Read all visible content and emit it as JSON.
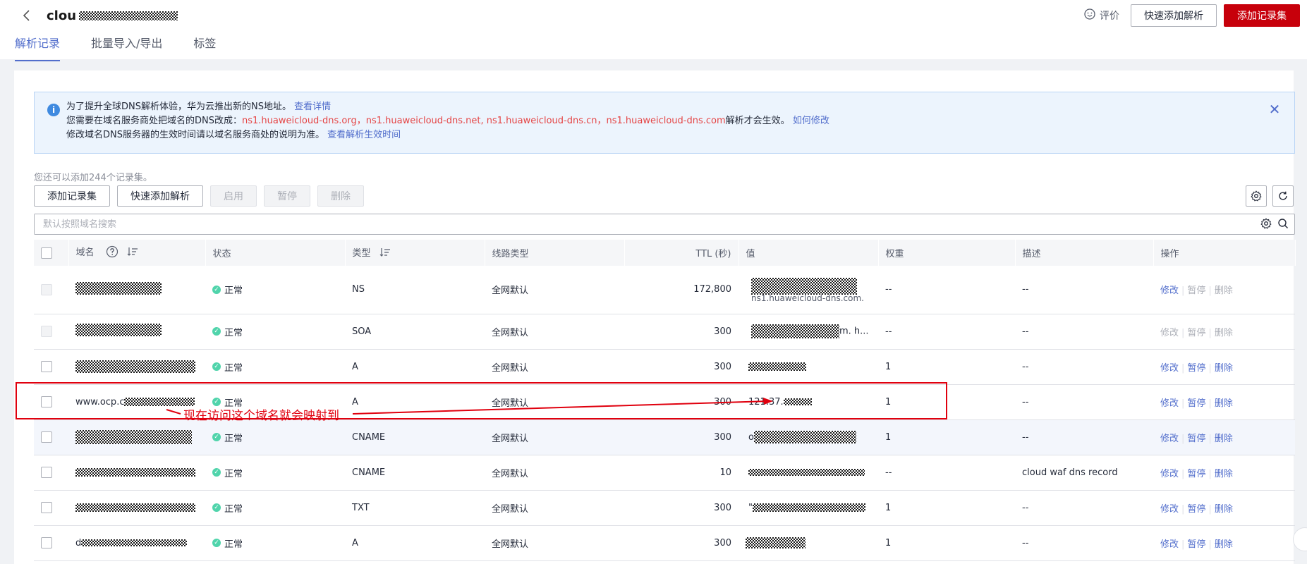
{
  "header": {
    "title": "clou",
    "tabs": [
      "解析记录",
      "批量导入/导出",
      "标签"
    ],
    "rate_label": "评价",
    "quick_add_label": "快速添加解析",
    "add_record_label": "添加记录集"
  },
  "banner": {
    "line1_text": "为了提升全球DNS解析体验，华为云推出新的NS地址。",
    "line1_link": "查看详情",
    "line2_prefix": "您需要在域名服务商处把域名的DNS改成：",
    "line2_ns": "ns1.huaweicloud-dns.org，ns1.huaweicloud-dns.net, ns1.huaweicloud-dns.cn，ns1.huaweicloud-dns.com",
    "line2_suffix": "解析才会生效。",
    "line2_link": "如何修改",
    "line3_text": "修改域名DNS服务器的生效时间请以域名服务商处的说明为准。",
    "line3_link": "查看解析生效时间"
  },
  "toolbar": {
    "remaining": "您还可以添加244个记录集。",
    "add_label": "添加记录集",
    "quick_label": "快速添加解析",
    "enable_label": "启用",
    "pause_label": "暂停",
    "delete_label": "删除"
  },
  "search": {
    "placeholder": "默认按照域名搜索"
  },
  "table": {
    "headers": {
      "name": "域名",
      "status": "状态",
      "type": "类型",
      "line": "线路类型",
      "ttl": "TTL (秒)",
      "value": "值",
      "weight": "权重",
      "desc": "描述",
      "ops": "操作"
    },
    "op_labels": {
      "modify": "修改",
      "pause": "暂停",
      "delete": "删除"
    },
    "rows": [
      {
        "name": "",
        "status": "正常",
        "type": "NS",
        "line": "全网默认",
        "ttl": "172,800",
        "value": "ns1.huaweicloud-dns.com.",
        "weight": "--",
        "desc": "--"
      },
      {
        "name": "",
        "status": "正常",
        "type": "SOA",
        "line": "全网默认",
        "ttl": "300",
        "value": "m. h...",
        "weight": "--",
        "desc": "--"
      },
      {
        "name": "",
        "status": "正常",
        "type": "A",
        "line": "全网默认",
        "ttl": "300",
        "value": "",
        "weight": "1",
        "desc": "--"
      },
      {
        "name": "www.ocp.c",
        "status": "正常",
        "type": "A",
        "line": "全网默认",
        "ttl": "300",
        "value": "121.37.",
        "weight": "1",
        "desc": "--"
      },
      {
        "name": "",
        "status": "正常",
        "type": "CNAME",
        "line": "全网默认",
        "ttl": "300",
        "value": "o",
        "weight": "1",
        "desc": "--"
      },
      {
        "name": "",
        "status": "正常",
        "type": "CNAME",
        "line": "全网默认",
        "ttl": "10",
        "value": "",
        "weight": "--",
        "desc": "cloud waf dns record"
      },
      {
        "name": "",
        "status": "正常",
        "type": "TXT",
        "line": "全网默认",
        "ttl": "300",
        "value": "\"",
        "weight": "1",
        "desc": "--"
      },
      {
        "name": "d",
        "status": "正常",
        "type": "A",
        "line": "全网默认",
        "ttl": "300",
        "value": "",
        "weight": "1",
        "desc": "--"
      }
    ]
  },
  "annotation": {
    "text": "现在访问这个域名就会映射到",
    "color": "#e0000e"
  },
  "colors": {
    "brand_red": "#c7000b",
    "link": "#526ecc",
    "ok": "#50d4ab"
  },
  "icons": [
    "back-arrow-icon",
    "smile-icon",
    "info-icon",
    "close-icon",
    "settings-icon",
    "refresh-icon",
    "search-icon",
    "help-circle-icon",
    "sort-icon"
  ]
}
